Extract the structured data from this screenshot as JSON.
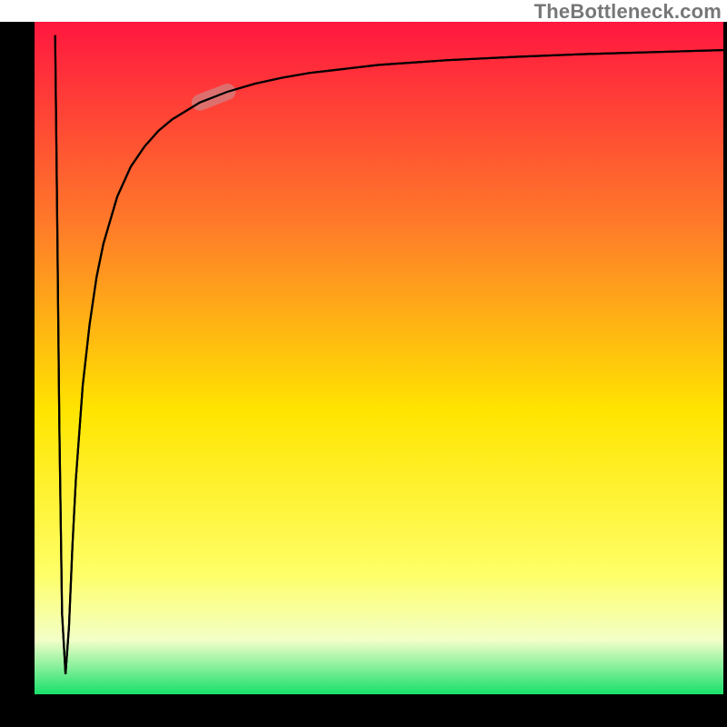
{
  "watermark": "TheBottleneck.com",
  "chart_data": {
    "type": "line",
    "title": "",
    "xlabel": "",
    "ylabel": "",
    "xlim": [
      0,
      100
    ],
    "ylim": [
      0,
      100
    ],
    "grid": false,
    "legend": false,
    "annotations": [
      {
        "kind": "highlight",
        "x_range": [
          24,
          31
        ],
        "note": "faded red band on curve"
      }
    ],
    "background_gradient": {
      "top_color": "#ff173f",
      "mid_colors": [
        "#ff7a2a",
        "#ffe500",
        "#f8ffbf"
      ],
      "bottom_color": "#18e06a"
    },
    "series": [
      {
        "name": "curve",
        "x": [
          3,
          3.3,
          3.6,
          4,
          4.5,
          5,
          5.5,
          6,
          7,
          8,
          9,
          10,
          12,
          14,
          16,
          18,
          20,
          24,
          28,
          32,
          36,
          40,
          50,
          60,
          70,
          80,
          90,
          100
        ],
        "y": [
          98,
          70,
          40,
          12,
          3,
          10,
          22,
          32,
          46,
          55,
          62,
          67,
          74,
          78.5,
          81.5,
          83.8,
          85.5,
          88,
          89.6,
          90.8,
          91.7,
          92.4,
          93.6,
          94.3,
          94.8,
          95.2,
          95.5,
          95.8
        ]
      }
    ]
  },
  "plot": {
    "margin_left": 38,
    "margin_right": 4,
    "margin_top": 24,
    "margin_bottom": 36
  }
}
